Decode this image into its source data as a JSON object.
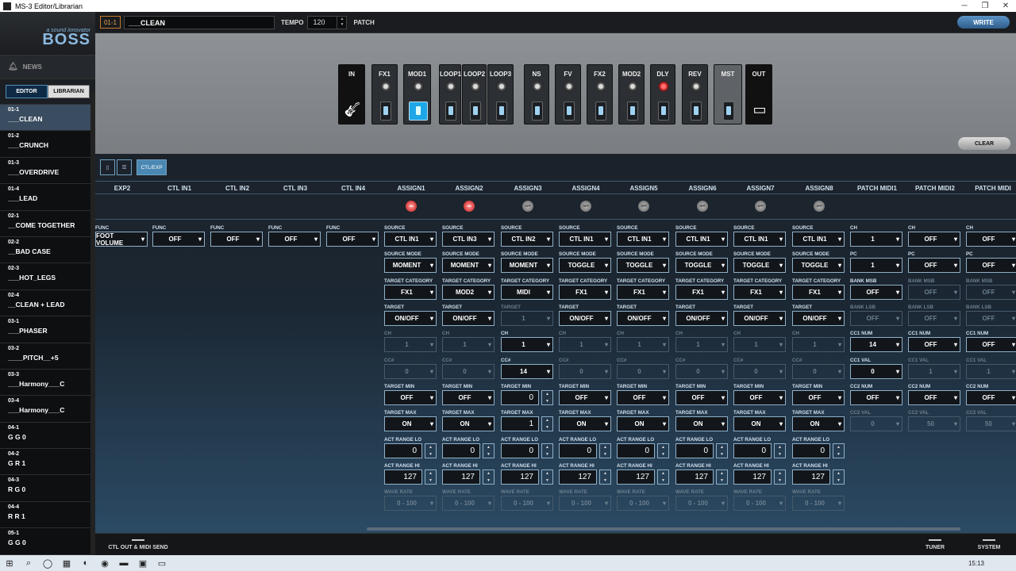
{
  "window": {
    "title": "MS-3 Editor/Librarian"
  },
  "header": {
    "patch_number": "01-1",
    "patch_name": "___CLEAN",
    "tempo_label": "TEMPO",
    "tempo_value": "120",
    "patch_label": "PATCH",
    "write_label": "WRITE"
  },
  "logo": {
    "tagline": "a sound innovator",
    "brand": "BOSS"
  },
  "sidebar": {
    "news_label": "NEWS",
    "editor_tab": "EDITOR",
    "librarian_tab": "LIBRARIAN",
    "patches": [
      {
        "num": "01-1",
        "name": "___CLEAN"
      },
      {
        "num": "01-2",
        "name": "___CRUNCH"
      },
      {
        "num": "01-3",
        "name": "___OVERDRIVE"
      },
      {
        "num": "01-4",
        "name": "___LEAD"
      },
      {
        "num": "02-1",
        "name": "__COME TOGETHER"
      },
      {
        "num": "02-2",
        "name": "__BAD CASE"
      },
      {
        "num": "02-3",
        "name": "___HOT_LEGS"
      },
      {
        "num": "02-4",
        "name": "__CLEAN + LEAD"
      },
      {
        "num": "03-1",
        "name": "___PHASER"
      },
      {
        "num": "03-2",
        "name": "____PITCH__+5"
      },
      {
        "num": "03-3",
        "name": "___Harmony___C"
      },
      {
        "num": "03-4",
        "name": "___Harmony___C"
      },
      {
        "num": "04-1",
        "name": "G G 0"
      },
      {
        "num": "04-2",
        "name": "G R 1"
      },
      {
        "num": "04-3",
        "name": "R G 0"
      },
      {
        "num": "04-4",
        "name": "R R 1"
      },
      {
        "num": "05-1",
        "name": "G G 0"
      }
    ]
  },
  "chain": {
    "blocks": [
      "IN",
      "FX1",
      "MOD1",
      "LOOP1",
      "LOOP2",
      "LOOP3",
      "NS",
      "FV",
      "FX2",
      "MOD2",
      "DLY",
      "REV",
      "MST",
      "OUT"
    ],
    "clear_label": "CLEAR"
  },
  "tabs": {
    "tab3": "CTL/EXP"
  },
  "columns": [
    "EXP2",
    "CTL IN1",
    "CTL IN2",
    "CTL IN3",
    "CTL IN4",
    "ASSIGN1",
    "ASSIGN2",
    "ASSIGN3",
    "ASSIGN4",
    "ASSIGN5",
    "ASSIGN6",
    "ASSIGN7",
    "ASSIGN8",
    "PATCH MIDI1",
    "PATCH MIDI2",
    "PATCH MIDI"
  ],
  "leds": [
    "ON",
    "ON",
    "OFF",
    "OFF",
    "OFF",
    "OFF",
    "OFF",
    "OFF"
  ],
  "labels": {
    "func": "FUNC",
    "source": "SOURCE",
    "source_mode": "SOURCE MODE",
    "target_category": "TARGET CATEGORY",
    "target": "TARGET",
    "ch": "CH",
    "cc": "CC#",
    "target_min": "TARGET MIN",
    "target_max": "TARGET MAX",
    "act_lo": "ACT RANGE LO",
    "act_hi": "ACT RANGE HI",
    "wave_rate": "WAVE RATE",
    "pc": "PC",
    "bank_msb": "BANK MSB",
    "bank_lsb": "BANK LSB",
    "cc1_num": "CC1 NUM",
    "cc1_val": "CC1 VAL",
    "cc2_num": "CC2 NUM",
    "cc2_val": "CC2 VAL"
  },
  "func_values": [
    "FOOT VOLUME",
    "OFF",
    "OFF",
    "OFF",
    "OFF"
  ],
  "assign": {
    "source": [
      "CTL IN1",
      "CTL IN3",
      "CTL IN2",
      "CTL IN1",
      "CTL IN1",
      "CTL IN1",
      "CTL IN1",
      "CTL IN1"
    ],
    "source_mode": [
      "MOMENT",
      "MOMENT",
      "MOMENT",
      "TOGGLE",
      "TOGGLE",
      "TOGGLE",
      "TOGGLE",
      "TOGGLE"
    ],
    "target_category": [
      "FX1",
      "MOD2",
      "MIDI",
      "FX1",
      "FX1",
      "FX1",
      "FX1",
      "FX1"
    ],
    "target": [
      "ON/OFF",
      "ON/OFF",
      "1",
      "ON/OFF",
      "ON/OFF",
      "ON/OFF",
      "ON/OFF",
      "ON/OFF"
    ],
    "ch": [
      "1",
      "1",
      "1",
      "1",
      "1",
      "1",
      "1",
      "1"
    ],
    "cc": [
      "0",
      "0",
      "14",
      "0",
      "0",
      "0",
      "0",
      "0"
    ],
    "target_min": [
      "OFF",
      "OFF",
      "0",
      "OFF",
      "OFF",
      "OFF",
      "OFF",
      "OFF"
    ],
    "target_max": [
      "ON",
      "ON",
      "1",
      "ON",
      "ON",
      "ON",
      "ON",
      "ON"
    ],
    "act_lo": [
      "0",
      "0",
      "0",
      "0",
      "0",
      "0",
      "0",
      "0"
    ],
    "act_hi": [
      "127",
      "127",
      "127",
      "127",
      "127",
      "127",
      "127",
      "127"
    ],
    "wave_rate": [
      "0 - 100",
      "0 - 100",
      "0 - 100",
      "0 - 100",
      "0 - 100",
      "0 - 100",
      "0 - 100",
      "0 - 100"
    ]
  },
  "midi": {
    "ch": [
      "1",
      "OFF",
      "OFF"
    ],
    "pc": [
      "1",
      "OFF",
      "OFF"
    ],
    "bank_msb": [
      "OFF",
      "OFF",
      "OFF"
    ],
    "bank_lsb": [
      "OFF",
      "OFF",
      "OFF"
    ],
    "cc1_num": [
      "14",
      "OFF",
      "OFF"
    ],
    "cc1_val": [
      "0",
      "1",
      "1"
    ],
    "cc2_num": [
      "OFF",
      "OFF",
      "OFF"
    ],
    "cc2_val": [
      "0",
      "50",
      "50"
    ]
  },
  "bottom": {
    "ctl_out": "CTL OUT & MIDI SEND",
    "tuner": "TUNER",
    "system": "SYSTEM"
  },
  "taskbar": {
    "time": "15:13"
  }
}
